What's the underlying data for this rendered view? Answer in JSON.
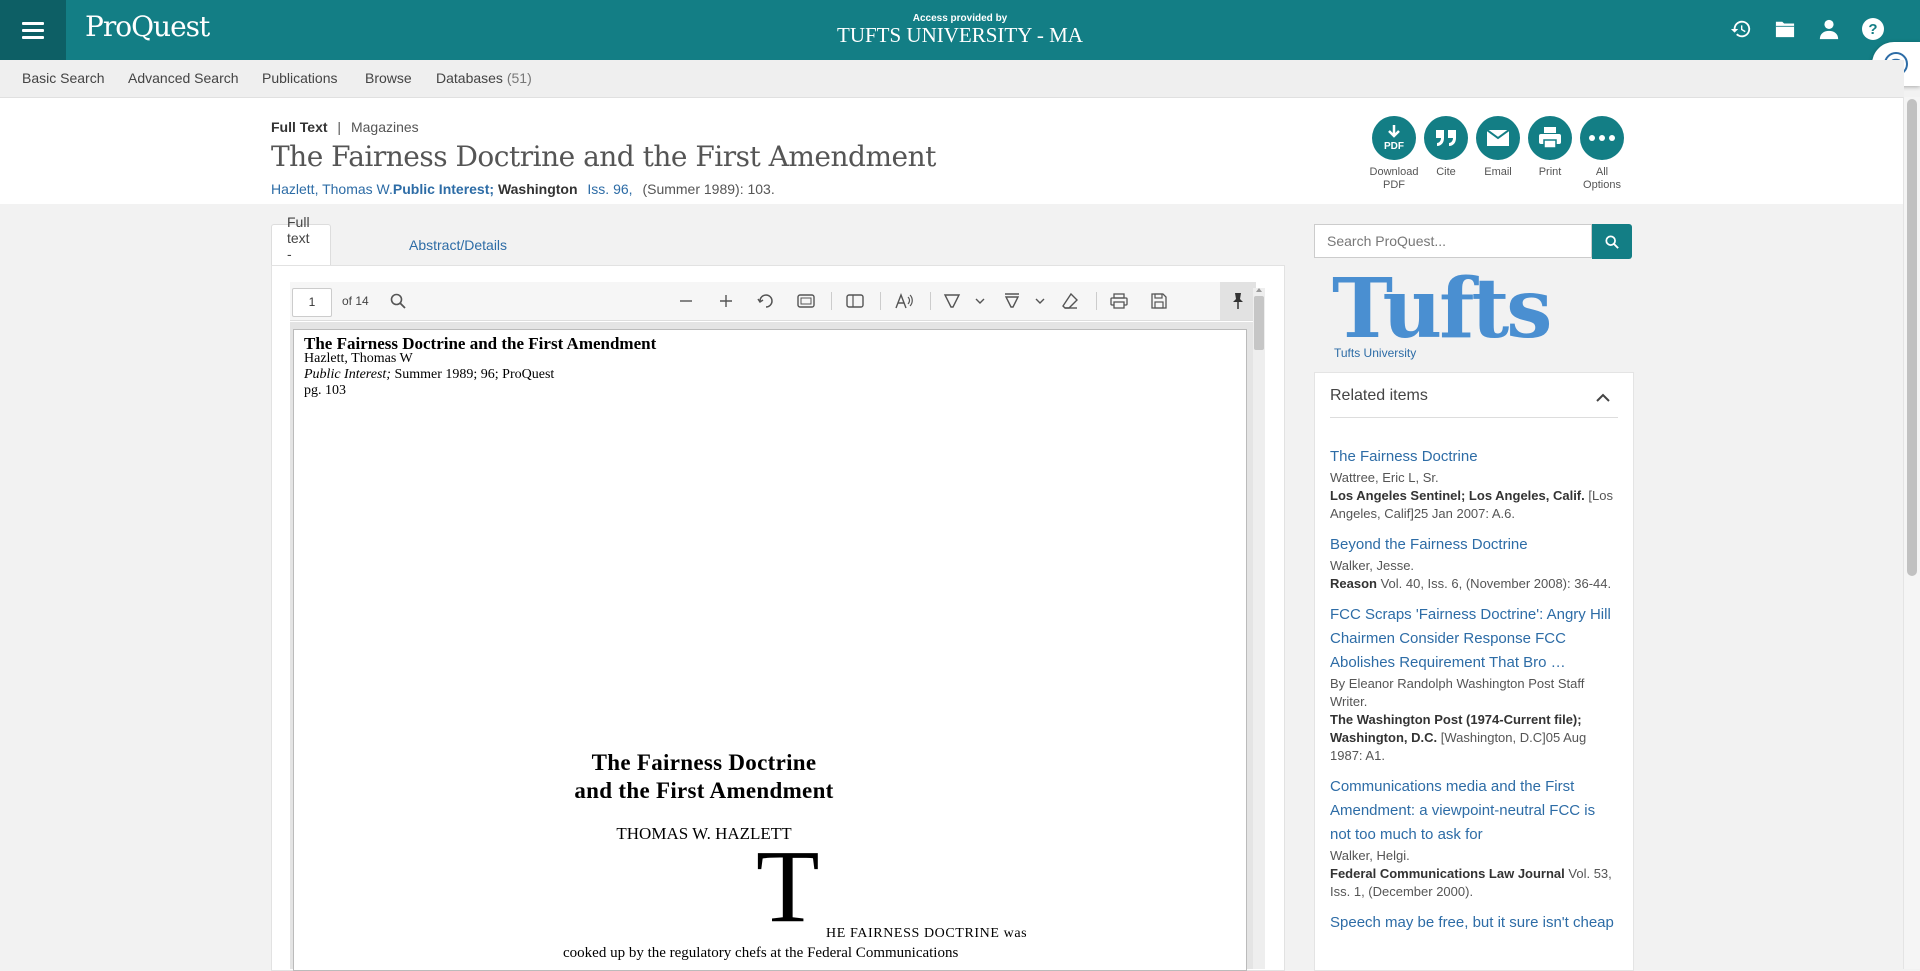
{
  "header": {
    "logo": "ProQuest",
    "access_label": "Access provided by",
    "institution": "TUFTS UNIVERSITY - MA",
    "icons": [
      "history-icon",
      "folder-icon",
      "user-icon",
      "help-icon"
    ]
  },
  "nav": {
    "basic_search": "Basic Search",
    "advanced_search": "Advanced Search",
    "publications": "Publications",
    "browse": "Browse",
    "databases": "Databases",
    "databases_count": "(51)"
  },
  "document": {
    "crumb_type": "Full Text",
    "crumb_sep": "|",
    "crumb_source": "Magazines",
    "title": "The Fairness Doctrine and the First Amendment",
    "author": "Hazlett, Thomas W.",
    "publication": "Public Interest; ",
    "place": "Washington",
    "issue": "Iss. 96,",
    "date_pages": "(Summer 1989): 103."
  },
  "actions": [
    {
      "label_1": "Download",
      "label_2": "PDF"
    },
    {
      "label_1": "Cite",
      "label_2": ""
    },
    {
      "label_1": "Email",
      "label_2": ""
    },
    {
      "label_1": "Print",
      "label_2": ""
    },
    {
      "label_1": "All",
      "label_2": "Options"
    }
  ],
  "tabs": {
    "full_text_pdf": "Full text - PDF",
    "abstract_details": "Abstract/Details"
  },
  "pdf_toolbar": {
    "page_value": "1",
    "page_of": "of 14"
  },
  "pdf_page": {
    "head_title": "The Fairness Doctrine and the First Amendment",
    "head_author": "Hazlett, Thomas W",
    "head_pub_italic": "Public Interest;",
    "head_pub_rest": " Summer 1989; 96; ProQuest",
    "head_pg": "pg. 103",
    "article_title_1": "The Fairness Doctrine",
    "article_title_2": "and the First Amendment",
    "article_author": "THOMAS W. HAZLETT",
    "drop_cap": "T",
    "body_line_1": "HE FAIRNESS DOCTRINE was",
    "body_line_2": "cooked up by the regulatory chefs at the Federal Communications"
  },
  "sidebar": {
    "search_placeholder": "Search ProQuest...",
    "institution_logo_text": "Tufts",
    "institution_name": "Tufts University",
    "related_heading": "Related items",
    "related": [
      {
        "title": "The Fairness Doctrine",
        "author": "Wattree, Eric L, Sr.",
        "source_bold": "Los Angeles Sentinel; Los Angeles, Calif.",
        "source_rest": " [Los Angeles, Calif]25 Jan 2007: A.6."
      },
      {
        "title": "Beyond the Fairness Doctrine",
        "author": "Walker, Jesse.",
        "source_bold": "Reason",
        "source_rest": " Vol. 40, Iss. 6,  (November 2008): 36-44."
      },
      {
        "title": "FCC Scraps 'Fairness Doctrine': Angry Hill Chairmen Consider Response FCC Abolishes Requirement That Bro …",
        "author": "By Eleanor Randolph Washington Post Staff Writer.",
        "source_bold": "The Washington Post (1974-Current file); Washington, D.C.",
        "source_rest": " [Washington, D.C]05 Aug 1987: A1."
      },
      {
        "title": "Communications media and the First Amendment: a viewpoint-neutral FCC is not too much to ask for",
        "author": "Walker, Helgi.",
        "source_bold": "Federal Communications Law Journal",
        "source_rest": " Vol. 53, Iss. 1,  (December 2000)."
      },
      {
        "title": "Speech may be free, but it sure isn't cheap",
        "author": "",
        "source_bold": "",
        "source_rest": ""
      }
    ]
  },
  "colors": {
    "brand_teal": "#137e85",
    "brand_teal_dark": "#0d5f65",
    "link_blue": "#2d6ca6",
    "tufts_blue": "#4a8fd1"
  }
}
